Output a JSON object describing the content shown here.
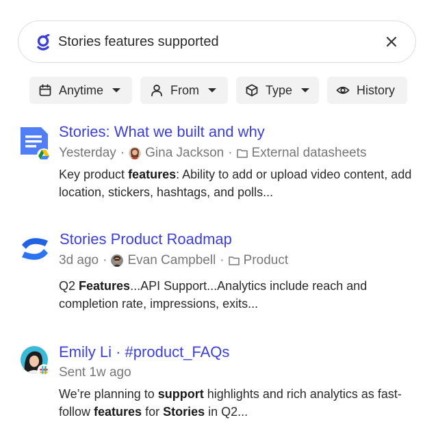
{
  "search": {
    "query": "Stories features supported",
    "logo_icon": "glean-logo-icon",
    "clear_icon": "close-icon",
    "brand_color": "#3b3fd8"
  },
  "filters": [
    {
      "label": "Anytime",
      "icon": "calendar-icon",
      "dropdown": true
    },
    {
      "label": "From",
      "icon": "person-icon",
      "dropdown": true
    },
    {
      "label": "Type",
      "icon": "cube-icon",
      "dropdown": true
    },
    {
      "label": "History",
      "icon": "eye-icon",
      "dropdown": false
    }
  ],
  "results": [
    {
      "title": "Stories: What we built and why",
      "source_icon": "google-docs-icon",
      "time": "Yesterday",
      "author": "Gina Jackson",
      "folder": "External datasheets",
      "snippet": [
        {
          "text": "Key product ",
          "bold": false
        },
        {
          "text": "features",
          "bold": true
        },
        {
          "text": ": Ability to add or upload video content, add location, stickers, hashtags, and polls...",
          "bold": false
        }
      ]
    },
    {
      "title": "Stories Product Roadmap",
      "source_icon": "confluence-icon",
      "time": "3d ago",
      "author": "Evan Campbell",
      "folder": "Product",
      "snippet": [
        {
          "text": "Q2 ",
          "bold": false
        },
        {
          "text": "Features",
          "bold": true
        },
        {
          "text": "...API Support...Analytics include reach and completion rate, impressions, exits...",
          "bold": false
        }
      ]
    },
    {
      "title": "Emily Li · #product_FAQs",
      "source_icon": "slack-icon",
      "time": "Sent 1w ago",
      "snippet": [
        {
          "text": "We’re planning to ",
          "bold": false
        },
        {
          "text": "support",
          "bold": true
        },
        {
          "text": " highlights and rich analytics as fast-follow ",
          "bold": false
        },
        {
          "text": "features",
          "bold": true
        },
        {
          "text": " for ",
          "bold": false
        },
        {
          "text": "Stories",
          "bold": true
        },
        {
          "text": " in Q2...",
          "bold": false
        }
      ]
    }
  ]
}
